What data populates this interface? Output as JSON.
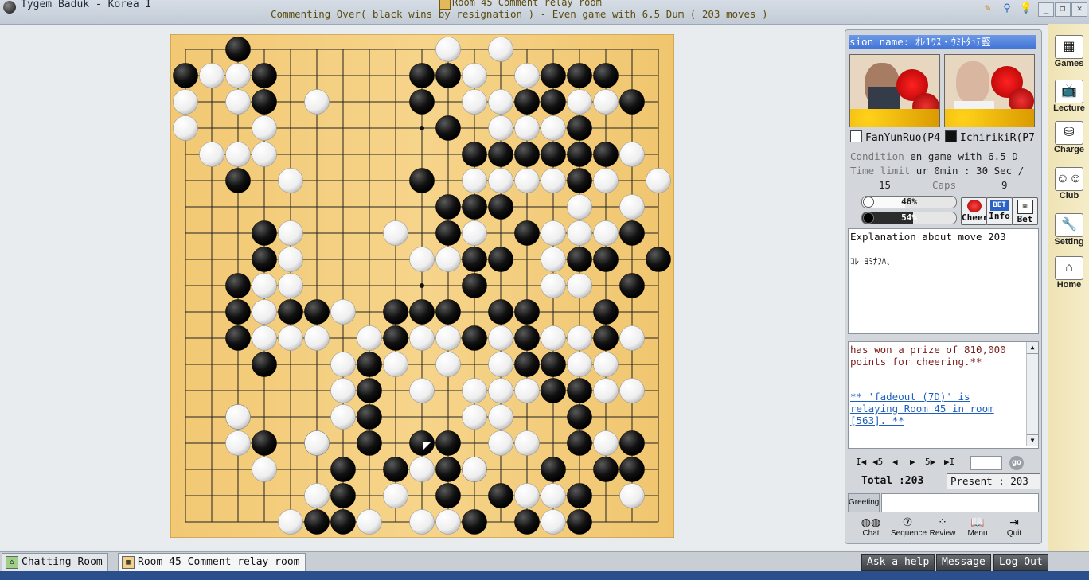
{
  "window": {
    "app_title": "Tygem Baduk - Korea I",
    "room_title": "Room 45 Comment relay room",
    "subtitle": "Commenting Over( black wins by resignation ) - Even game with 6.5 Dum  ( 203 moves )"
  },
  "board": {
    "size": 19,
    "star_points": [
      [
        3,
        3
      ],
      [
        3,
        9
      ],
      [
        3,
        15
      ],
      [
        9,
        3
      ],
      [
        9,
        9
      ],
      [
        9,
        15
      ],
      [
        15,
        3
      ],
      [
        15,
        9
      ],
      [
        15,
        15
      ]
    ],
    "last_move": [
      9,
      15
    ],
    "black": [
      [
        2,
        0
      ],
      [
        0,
        1
      ],
      [
        3,
        1
      ],
      [
        3,
        2
      ],
      [
        2,
        5
      ],
      [
        9,
        1
      ],
      [
        10,
        1
      ],
      [
        9,
        2
      ],
      [
        10,
        3
      ],
      [
        14,
        1
      ],
      [
        15,
        1
      ],
      [
        16,
        1
      ],
      [
        13,
        2
      ],
      [
        14,
        2
      ],
      [
        17,
        2
      ],
      [
        15,
        3
      ],
      [
        11,
        4
      ],
      [
        12,
        4
      ],
      [
        13,
        4
      ],
      [
        14,
        4
      ],
      [
        15,
        4
      ],
      [
        16,
        4
      ],
      [
        9,
        5
      ],
      [
        15,
        5
      ],
      [
        10,
        6
      ],
      [
        11,
        6
      ],
      [
        12,
        6
      ],
      [
        3,
        7
      ],
      [
        10,
        7
      ],
      [
        13,
        7
      ],
      [
        17,
        7
      ],
      [
        3,
        8
      ],
      [
        11,
        8
      ],
      [
        12,
        8
      ],
      [
        15,
        8
      ],
      [
        16,
        8
      ],
      [
        18,
        8
      ],
      [
        2,
        9
      ],
      [
        11,
        9
      ],
      [
        17,
        9
      ],
      [
        2,
        10
      ],
      [
        4,
        10
      ],
      [
        5,
        10
      ],
      [
        8,
        10
      ],
      [
        9,
        10
      ],
      [
        10,
        10
      ],
      [
        12,
        10
      ],
      [
        13,
        10
      ],
      [
        16,
        10
      ],
      [
        2,
        11
      ],
      [
        8,
        11
      ],
      [
        11,
        11
      ],
      [
        13,
        11
      ],
      [
        16,
        11
      ],
      [
        3,
        12
      ],
      [
        7,
        12
      ],
      [
        13,
        12
      ],
      [
        14,
        12
      ],
      [
        7,
        13
      ],
      [
        14,
        13
      ],
      [
        15,
        13
      ],
      [
        2,
        14
      ],
      [
        7,
        14
      ],
      [
        15,
        14
      ],
      [
        3,
        15
      ],
      [
        5,
        15
      ],
      [
        7,
        15
      ],
      [
        9,
        15
      ],
      [
        10,
        15
      ],
      [
        15,
        15
      ],
      [
        17,
        15
      ],
      [
        6,
        16
      ],
      [
        8,
        16
      ],
      [
        10,
        16
      ],
      [
        11,
        16
      ],
      [
        14,
        16
      ],
      [
        16,
        16
      ],
      [
        17,
        16
      ],
      [
        6,
        17
      ],
      [
        10,
        17
      ],
      [
        12,
        17
      ],
      [
        15,
        17
      ],
      [
        5,
        18
      ],
      [
        6,
        18
      ],
      [
        11,
        18
      ],
      [
        13,
        18
      ],
      [
        15,
        18
      ],
      [
        12,
        19
      ],
      [
        13,
        19
      ]
    ],
    "white": [
      [
        10,
        0
      ],
      [
        12,
        0
      ],
      [
        1,
        1
      ],
      [
        2,
        1
      ],
      [
        11,
        1
      ],
      [
        13,
        1
      ],
      [
        0,
        2
      ],
      [
        2,
        2
      ],
      [
        5,
        2
      ],
      [
        11,
        2
      ],
      [
        12,
        2
      ],
      [
        15,
        2
      ],
      [
        16,
        2
      ],
      [
        0,
        3
      ],
      [
        3,
        3
      ],
      [
        12,
        3
      ],
      [
        13,
        3
      ],
      [
        14,
        3
      ],
      [
        1,
        4
      ],
      [
        2,
        4
      ],
      [
        3,
        4
      ],
      [
        17,
        4
      ],
      [
        4,
        5
      ],
      [
        11,
        5
      ],
      [
        12,
        5
      ],
      [
        13,
        5
      ],
      [
        14,
        5
      ],
      [
        16,
        5
      ],
      [
        18,
        5
      ],
      [
        15,
        6
      ],
      [
        17,
        6
      ],
      [
        4,
        7
      ],
      [
        8,
        7
      ],
      [
        11,
        7
      ],
      [
        14,
        7
      ],
      [
        15,
        7
      ],
      [
        16,
        7
      ],
      [
        4,
        8
      ],
      [
        9,
        8
      ],
      [
        10,
        8
      ],
      [
        14,
        8
      ],
      [
        3,
        9
      ],
      [
        4,
        9
      ],
      [
        14,
        9
      ],
      [
        15,
        9
      ],
      [
        3,
        10
      ],
      [
        6,
        10
      ],
      [
        3,
        11
      ],
      [
        4,
        11
      ],
      [
        5,
        11
      ],
      [
        7,
        11
      ],
      [
        9,
        11
      ],
      [
        10,
        11
      ],
      [
        12,
        11
      ],
      [
        14,
        11
      ],
      [
        15,
        11
      ],
      [
        17,
        11
      ],
      [
        6,
        12
      ],
      [
        8,
        12
      ],
      [
        10,
        12
      ],
      [
        12,
        12
      ],
      [
        15,
        12
      ],
      [
        16,
        12
      ],
      [
        6,
        13
      ],
      [
        9,
        13
      ],
      [
        11,
        13
      ],
      [
        12,
        13
      ],
      [
        13,
        13
      ],
      [
        16,
        13
      ],
      [
        17,
        13
      ],
      [
        2,
        14
      ],
      [
        6,
        14
      ],
      [
        11,
        14
      ],
      [
        12,
        14
      ],
      [
        2,
        15
      ],
      [
        5,
        15
      ],
      [
        12,
        15
      ],
      [
        13,
        15
      ],
      [
        16,
        15
      ],
      [
        3,
        16
      ],
      [
        9,
        16
      ],
      [
        11,
        16
      ],
      [
        5,
        17
      ],
      [
        8,
        17
      ],
      [
        13,
        17
      ],
      [
        14,
        17
      ],
      [
        17,
        17
      ],
      [
        4,
        18
      ],
      [
        7,
        18
      ],
      [
        9,
        18
      ],
      [
        10,
        18
      ],
      [
        14,
        18
      ],
      [
        14,
        19
      ],
      [
        15,
        19
      ]
    ]
  },
  "panel": {
    "session_label": "sion name: ｵﾚ1ﾜｽ・ｳﾐﾄﾀｭﾃ竪",
    "white_player": "FanYunRuo(P4",
    "black_player": "IchirikiR(P7",
    "condition_label": "Condition",
    "condition_value": "en game with 6.5 D",
    "time_label": "Time limit",
    "time_value": "ur 0min : 30 Sec /",
    "white_caps": "15",
    "caps_label": "Caps",
    "black_caps": "9",
    "white_pct": "46%",
    "black_pct": "54%",
    "white_fraction": 0.46,
    "black_fraction": 0.54,
    "cheer_label": "Cheer",
    "info_label": "Info",
    "bet_label": "Bet",
    "bet_badge": "BET",
    "explain_title": "Explanation about move 203",
    "explain_text": "ｺﾚ ﾖﾐﾅﾌﾊ、",
    "chat_line1": "has won a prize of 810,000",
    "chat_line2": "points for cheering.**",
    "chat_link1": "** 'fadeout (7D)' is",
    "chat_link2": "relaying Room 45 in room",
    "chat_link3": "[563]. **",
    "nav_first": "I◀",
    "nav_back5": "◀5",
    "nav_back": "◀",
    "nav_fwd": "▶",
    "nav_fwd5": "5▶",
    "nav_last": "▶I",
    "go_label": "go",
    "total_label": "Total :203",
    "present_label": "Present : 203",
    "greeting_label": "Greeting",
    "buttons": [
      "Chat",
      "Sequence",
      "Review",
      "Menu",
      "Quit"
    ]
  },
  "sidebar": [
    "Games",
    "Lecture",
    "Charge",
    "Club",
    "Setting",
    "Home"
  ],
  "tabs": [
    "Chatting Room",
    "Room 45 Comment relay room"
  ],
  "actions": [
    "Ask a help",
    "Message",
    "Log Out"
  ]
}
